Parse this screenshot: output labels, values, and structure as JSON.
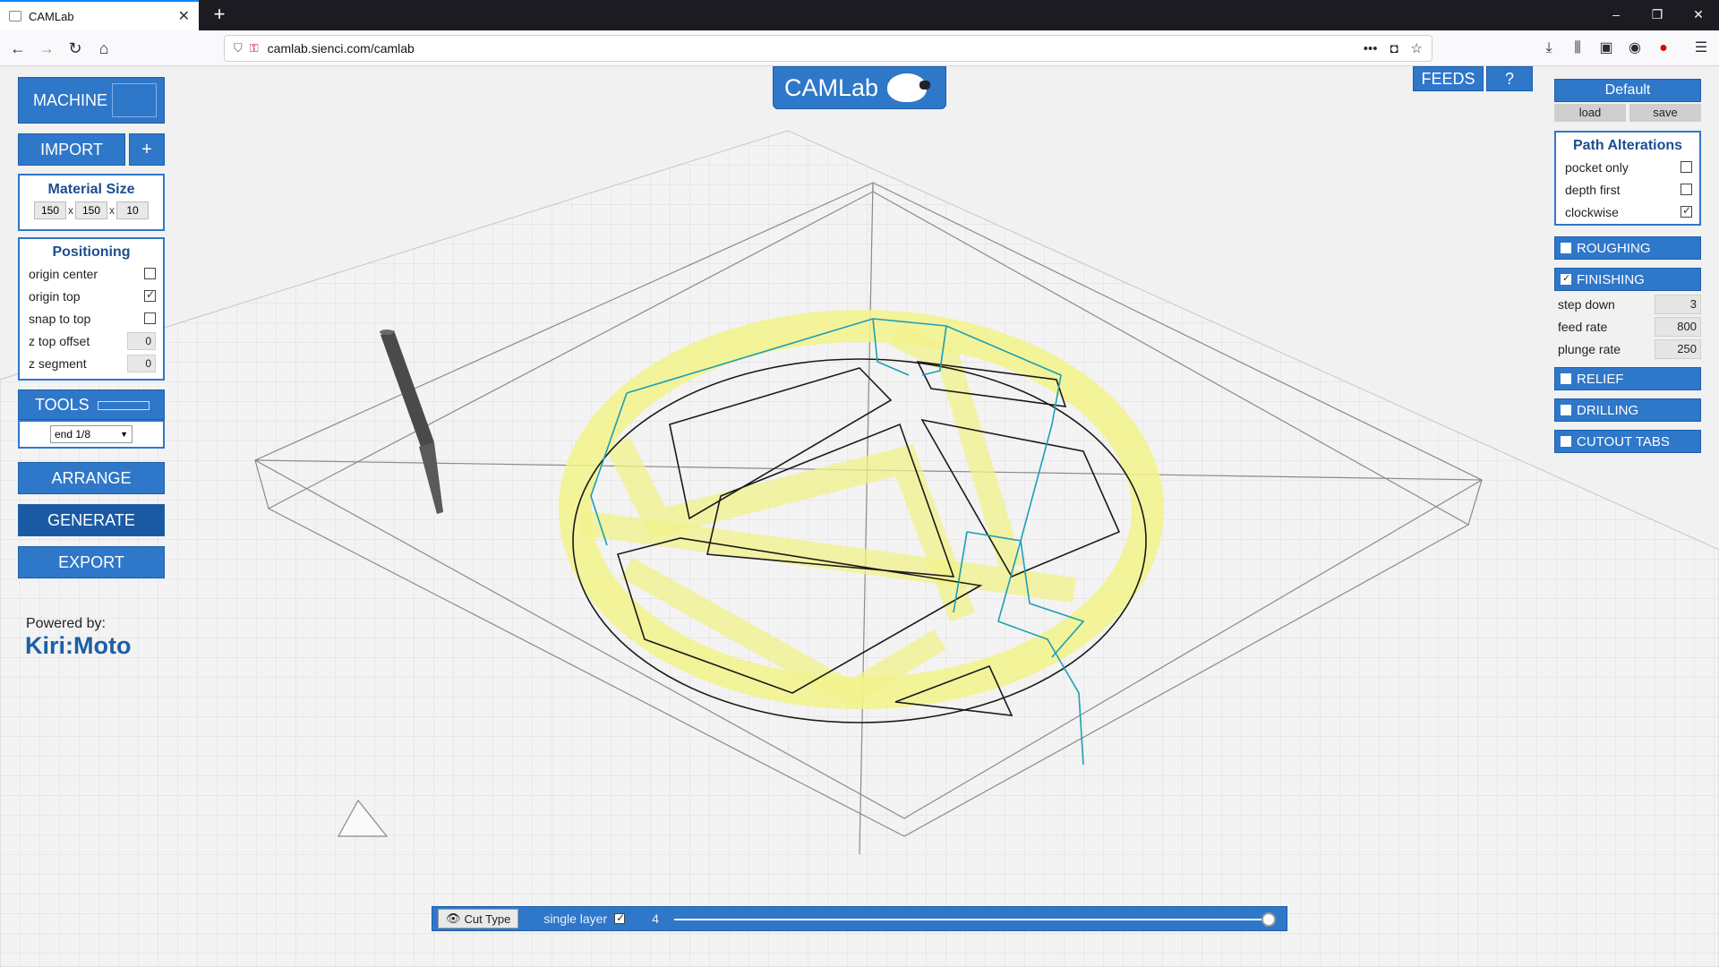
{
  "browser": {
    "tab_title": "CAMLab",
    "new_tab_symbol": "+",
    "url": "camlab.sienci.com/camlab",
    "window_controls": [
      "–",
      "❐",
      "✕"
    ]
  },
  "app": {
    "logo_text": "CAMLab",
    "feeds_label": "FEEDS",
    "help_label": "?",
    "powered_by": "Powered by:",
    "powered_brand": "Kiri:Moto"
  },
  "left": {
    "machine_label": "MACHINE",
    "import_label": "IMPORT",
    "import_add": "+",
    "material": {
      "title": "Material Size",
      "x": "150",
      "y": "150",
      "z": "10",
      "sep": "x"
    },
    "positioning": {
      "title": "Positioning",
      "rows": [
        {
          "label": "origin center",
          "checked": false
        },
        {
          "label": "origin top",
          "checked": true
        },
        {
          "label": "snap to top",
          "checked": false
        }
      ],
      "z_top_offset_label": "z top offset",
      "z_top_offset": "0",
      "z_segment_label": "z segment",
      "z_segment": "0"
    },
    "tools_label": "TOOLS",
    "tool_selected": "end 1/8",
    "arrange_label": "ARRANGE",
    "generate_label": "GENERATE",
    "export_label": "EXPORT"
  },
  "right": {
    "profile": "Default",
    "load_label": "load",
    "save_label": "save",
    "path_alterations": {
      "title": "Path Alterations",
      "rows": [
        {
          "label": "pocket only",
          "checked": false
        },
        {
          "label": "depth first",
          "checked": false
        },
        {
          "label": "clockwise",
          "checked": true
        }
      ]
    },
    "roughing_label": "ROUGHING",
    "finishing_label": "FINISHING",
    "finishing_params": [
      {
        "label": "step down",
        "value": "3"
      },
      {
        "label": "feed rate",
        "value": "800"
      },
      {
        "label": "plunge rate",
        "value": "250"
      }
    ],
    "relief_label": "RELIEF",
    "drilling_label": "DRILLING",
    "cutout_tabs_label": "CUTOUT TABS"
  },
  "bottom": {
    "cut_type_label": "Cut Type",
    "single_layer_label": "single layer",
    "single_layer_checked": true,
    "layer_value": "4"
  },
  "colors": {
    "accent": "#2f77c9",
    "accent_dark": "#1a5aa3",
    "toolpath_yellow": "#f2f28a",
    "toolpath_cyan": "#1b9fb5"
  }
}
